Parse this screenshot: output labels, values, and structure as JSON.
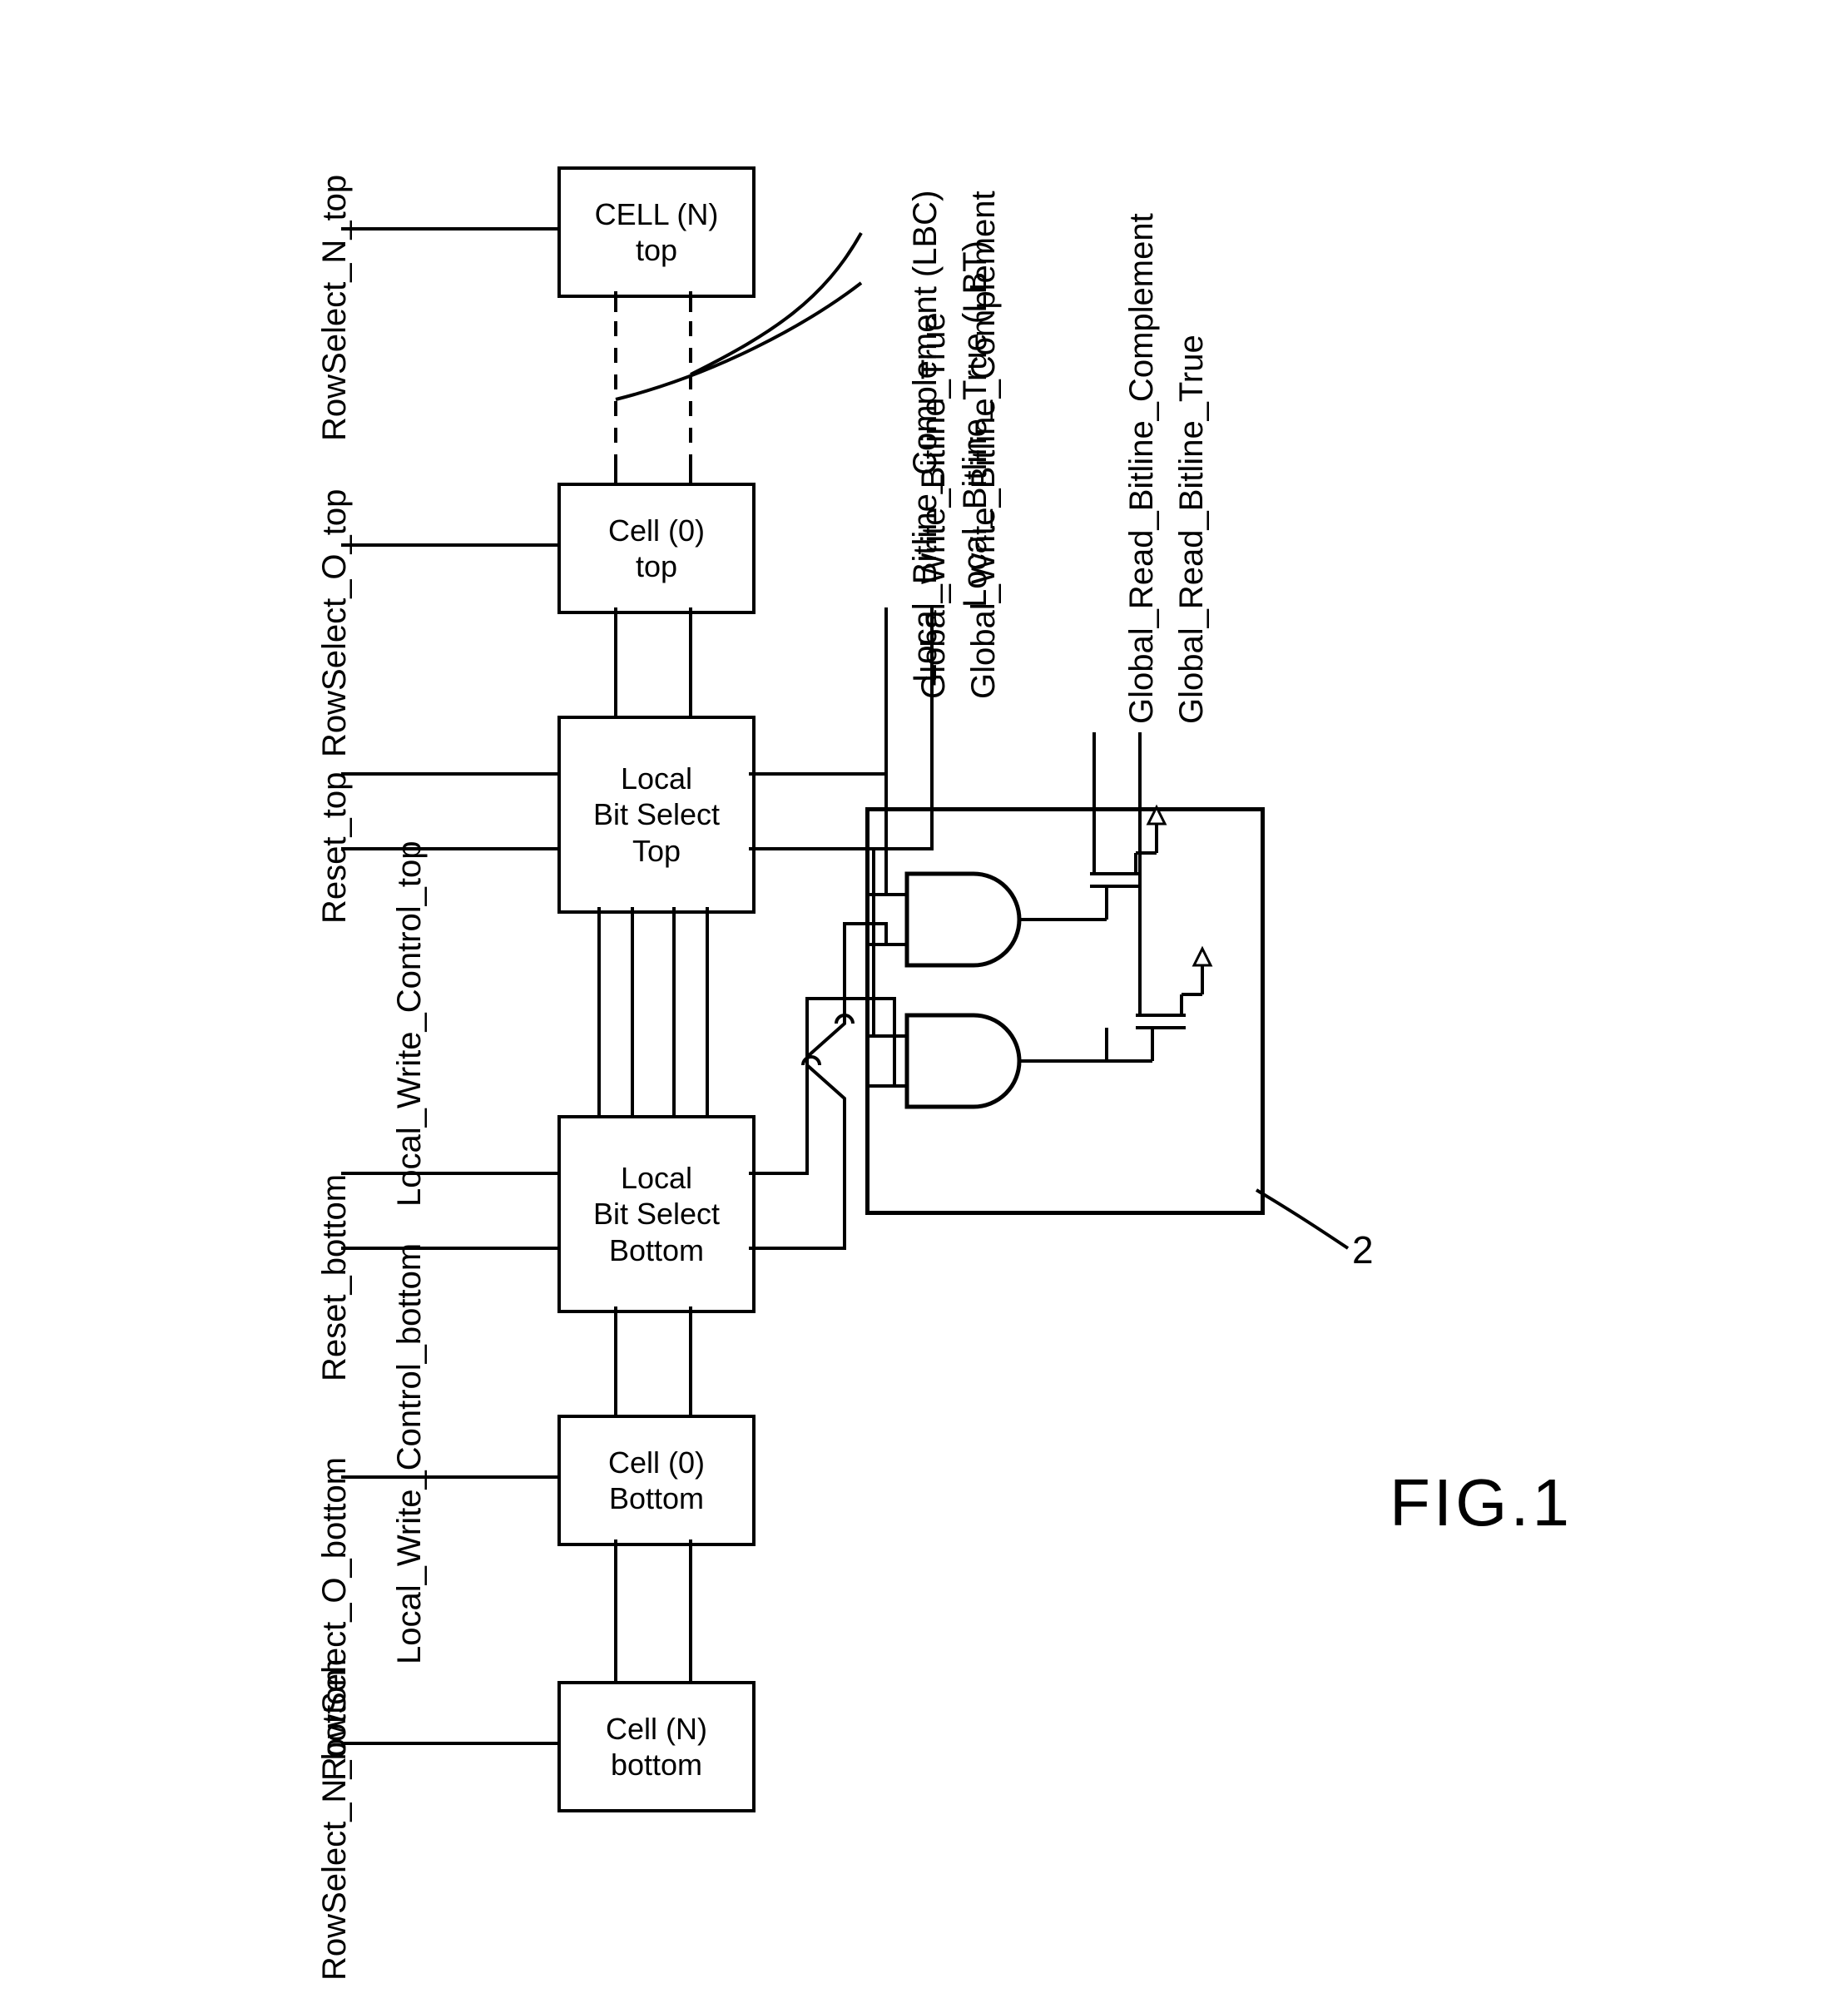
{
  "figure_label": "FIG.1",
  "big_box_ref": "2",
  "blocks": {
    "cell_n_top": {
      "line1": "CELL (N)",
      "line2": "top"
    },
    "cell_0_top": {
      "line1": "Cell (0)",
      "line2": "top"
    },
    "lbs_top": {
      "line1": "Local",
      "line2": "Bit Select",
      "line3": "Top"
    },
    "lbs_bottom": {
      "line1": "Local",
      "line2": "Bit Select",
      "line3": "Bottom"
    },
    "cell_0_bottom": {
      "line1": "Cell (0)",
      "line2": "Bottom"
    },
    "cell_n_bottom": {
      "line1": "Cell (N)",
      "line2": "bottom"
    }
  },
  "left_signals": {
    "row_n_top": "RowSelect_N_top",
    "row_0_top": "RowSelect_O_top",
    "reset_top": "Reset_top",
    "lwc_top": "Local_Write_Control_top",
    "reset_bot": "Reset_bottom",
    "lwc_bot": "Local_Write_Control_bottom",
    "row_0_bot": "RowSelect_O_bottom",
    "row_n_bot": "RowSelect_N_bottom"
  },
  "top_signals": {
    "lbc": "Local_Bitline_Complement (LBC)",
    "lbt": "Local_Bitline_True (LBT)"
  },
  "mid_signals": {
    "gwbt": "Global_Write_Bitline_True",
    "gwbc": "Global_Write_Bitline_Complement"
  },
  "right_signals": {
    "grbc": "Global_Read_Bitline_Complement",
    "grbt": "Global_Read_Bitline_True"
  }
}
